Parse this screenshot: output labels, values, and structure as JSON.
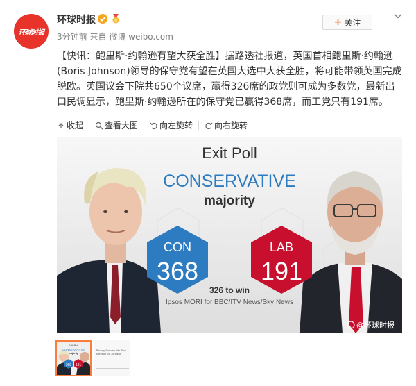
{
  "account": {
    "name": "环球时报",
    "avatar_text": "环球时报",
    "follow_label": "关注",
    "follow_plus": "+"
  },
  "meta": {
    "time": "3分钟前",
    "from_label": "来自",
    "source": "微博",
    "site": "weibo.com"
  },
  "post": {
    "hashtag": "【快讯：鲍里斯·约翰逊有望大获全胜】",
    "body": "据路透社报道，英国首相鲍里斯·约翰逊(Boris Johnson)领导的保守党有望在英国大选中大获全胜，将可能带领英国完成脱欧。英国议会下院共650个议席，赢得326席的政党则可成为多数党，最新出口民调显示，鲍里斯·约翰逊所在的保守党已赢得368席，而工党只有191席。"
  },
  "toolbar": {
    "collapse": "收起",
    "view_large": "查看大图",
    "rotate_left": "向左旋转",
    "rotate_right": "向右旋转"
  },
  "image": {
    "heading": "Exit Poll",
    "party_line": "CONSERVATIVE",
    "result_word": "majority",
    "con_label": "CON",
    "con_seats": "368",
    "lab_label": "LAB",
    "lab_seats": "191",
    "to_win": "326 to win",
    "credit": "Ipsos MORI for BBC/ITV News/Sky News",
    "watermark": "@环球时报",
    "con_color": "#2d7cc1",
    "lab_color": "#c8102e"
  },
  "thumb2": {
    "caption": "Bloody Sunday hits Tory Election for Johnson"
  }
}
